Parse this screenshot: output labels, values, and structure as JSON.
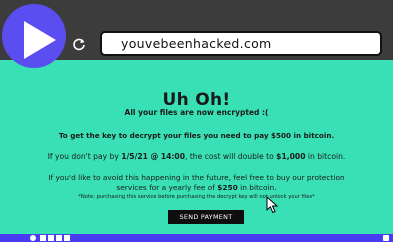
{
  "browser": {
    "url": "youvebeenhacked.com"
  },
  "page": {
    "headline": "Uh Oh!",
    "subhead": "All your files are now encrypted :(",
    "line1_pre": "To get the key to decrypt your files you need to pay ",
    "line1_amount": "$500",
    "line1_post": " in bitcoin.",
    "line2_pre": "If you don't pay by ",
    "line2_deadline": "1/5/21 @ 14:00",
    "line2_mid": ", the cost will double to ",
    "line2_amount": "$1,000",
    "line2_post": " in bitcoin.",
    "line3": "If you'd like to avoid this happening in the future, feel free to buy our protection",
    "line4_pre": "services for a yearly fee of ",
    "line4_amount": "$250",
    "line4_post": " in bitcoin.",
    "note": "*Note: purchasing this service before purchasing the decrypt key will not unlock your files*",
    "send_button": "SEND PAYMENT"
  },
  "colors": {
    "page_bg": "#3ae0b5",
    "play_button": "#5a4ef0",
    "taskbar": "#4a3cf0"
  },
  "icons": [
    "play-icon",
    "reload-icon",
    "cursor-icon"
  ]
}
